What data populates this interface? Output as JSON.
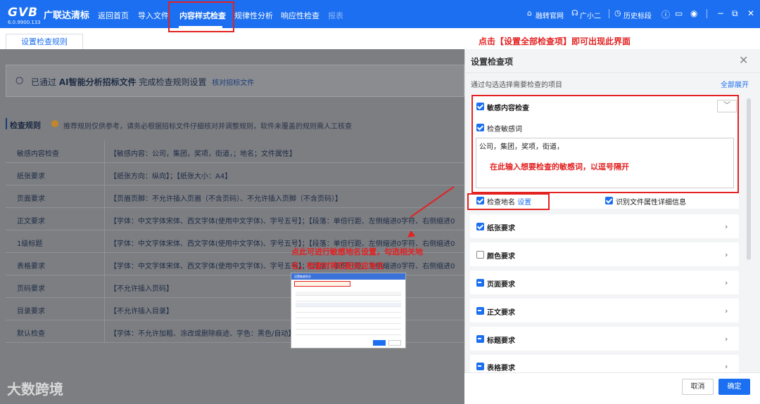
{
  "app": {
    "logo": "GVB",
    "logo_cn": "广联达清标",
    "version": "6.0.9900.133"
  },
  "nav": {
    "items": [
      "返回首页",
      "导入文件",
      "内容样式检查",
      "规律性分析",
      "响应性检查",
      "报表"
    ],
    "active": "内容样式检查"
  },
  "topbar_right": {
    "official_site": "融转官网",
    "assistant": "广小二",
    "history": "历史标段"
  },
  "tabs": {
    "rules_tab": "设置检查规则"
  },
  "annotation_top": "点击【设置全部检查项】即可出现此界面",
  "search": {
    "prefix": "已通过",
    "ai_text": "AI智能分析招标文件",
    "suffix": "完成检查规则设置",
    "link": "核对招标文件"
  },
  "rules": {
    "title": "检查规则",
    "tip": "推荐规则仅供参考，请务必根据招标文件仔细核对并调整规则，软件未覆盖的规则需人工核查",
    "rows": [
      {
        "label": "敏感内容检查",
        "value": "【敏感内容：公司，集团，奖项，街道，；地名；文件属性】"
      },
      {
        "label": "纸张要求",
        "value": "【纸张方向：纵向】；【纸张大小：A4】"
      },
      {
        "label": "页面要求",
        "value": "【页眉页脚：不允许插入页眉（不含页码）、不允许插入页脚（不含页码）】"
      },
      {
        "label": "正文要求",
        "value": "【字体：中文字体宋体、西文字体(使用中文字体)、字号五号】；【段落：单倍行距、左侧缩进0字符、右侧缩进0"
      },
      {
        "label": "1级标题",
        "value": "【字体：中文字体宋体、西文字体(使用中文字体)、字号五号】；【段落：单倍行距、左侧缩进0字符、右侧缩进0"
      },
      {
        "label": "表格要求",
        "value": "【字体：中文字体宋体、西文字体(使用中文字体)、字号五号】；【段落：单倍行距、左侧缩进0字符、右侧缩进0"
      },
      {
        "label": "页码要求",
        "value": "【不允许插入页码】"
      },
      {
        "label": "目录要求",
        "value": "【不允许插入目录】"
      },
      {
        "label": "默认检查",
        "value": "【字体：不允许加粗、涂改或删除痕迹、字色：黑色/自动】"
      }
    ]
  },
  "annotation_mid": "点此可进行敏感地名设置，勾选相关地名，检查时将匹配对应地名",
  "mini_dialog": {
    "title": "设置敏感地名",
    "warning": "勾选需要检查的地名，软件将逐项检查",
    "ok": "确定",
    "cancel": "取消"
  },
  "watermark": "大数跨境",
  "panel": {
    "title": "设置检查项",
    "subtitle": "通过勾选选择需要检查的项目",
    "expand_all": "全部展开",
    "sensitive": {
      "title": "敏感内容检查",
      "check_words": "检查敏感词",
      "words_value": "公司，集团，奖项，街道，",
      "hint": "在此输入想要检查的敏感词，以逗号隔开",
      "check_place": "检查地名",
      "place_setting": "设置",
      "file_attr": "识别文件属性详细信息"
    },
    "sections": [
      {
        "label": "纸张要求",
        "state": "checked"
      },
      {
        "label": "颜色要求",
        "state": "unchecked"
      },
      {
        "label": "页面要求",
        "state": "partial"
      },
      {
        "label": "正文要求",
        "state": "partial"
      },
      {
        "label": "标题要求",
        "state": "partial"
      },
      {
        "label": "表格要求",
        "state": "partial"
      }
    ],
    "cancel": "取消",
    "confirm": "确定"
  }
}
